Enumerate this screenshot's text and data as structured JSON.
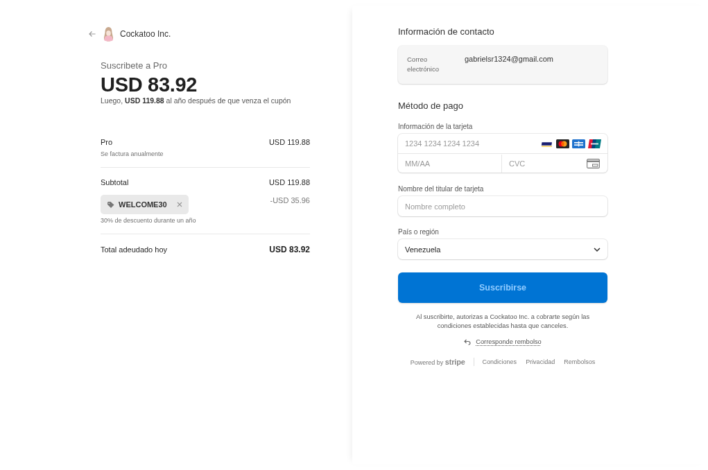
{
  "merchant": {
    "name": "Cockatoo Inc."
  },
  "summary": {
    "title": "Suscribete a Pro",
    "amount": "USD 83.92",
    "note": "Luego, **USD 119.88** al año después de que venza el cupón"
  },
  "order": {
    "product": {
      "name": "Pro",
      "detail": "Se factura anualmente",
      "amount": "USD 119.88"
    },
    "subtotal": {
      "label": "Subtotal",
      "amount": "USD 119.88"
    },
    "coupon": {
      "code": "WELCOME30",
      "amount": "-USD 35.96",
      "detail": "30% de descuento durante un año"
    },
    "total": {
      "label": "Total adeudado hoy",
      "amount": "USD 83.92"
    }
  },
  "contact": {
    "heading": "Información de contacto",
    "email_label": "Correo electrónico",
    "email": "gabrielsr1324@gmail.com"
  },
  "payment": {
    "heading": "Método de pago",
    "card": {
      "label": "Información de la tarjeta",
      "number_placeholder": "1234 1234 1234 1234",
      "expiry_placeholder": "MM/AA",
      "cvc_placeholder": "CVC"
    },
    "cardholder": {
      "label": "Nombre del titular de tarjeta",
      "placeholder": "Nombre completo"
    },
    "country": {
      "label": "País o región",
      "value": "Venezuela"
    }
  },
  "submit_button": {
    "label": "Suscribirse"
  },
  "legal": "Al suscribirte, autorizas a Cockatoo Inc. a cobrarte según las condiciones establecidas hasta que canceles.",
  "refund_link": "Corresponde rembolso",
  "footer": {
    "powered_by": "Powered by **stripe**",
    "links": [
      "Condiciones",
      "Privacidad",
      "Rembolsos"
    ]
  }
}
